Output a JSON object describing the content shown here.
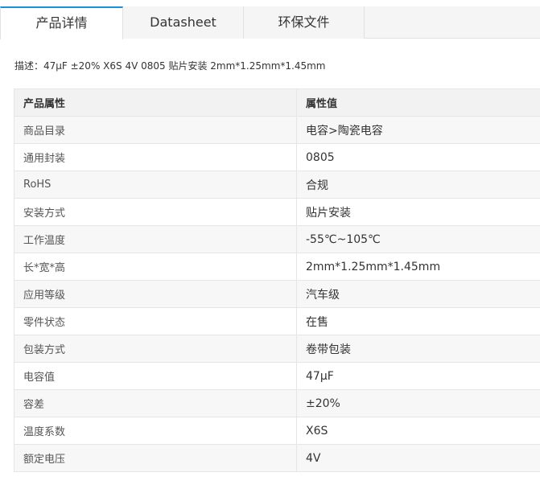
{
  "tabs": [
    {
      "label": "产品详情",
      "active": true
    },
    {
      "label": "Datasheet",
      "active": false
    },
    {
      "label": "环保文件",
      "active": false
    }
  ],
  "description": "描述：47μF ±20% X6S 4V 0805 贴片安装 2mm*1.25mm*1.45mm",
  "table": {
    "headers": [
      "产品属性",
      "属性值"
    ],
    "rows": [
      [
        "商品目录",
        "电容>陶瓷电容"
      ],
      [
        "通用封装",
        "0805"
      ],
      [
        "RoHS",
        "合规"
      ],
      [
        "安装方式",
        "贴片安装"
      ],
      [
        "工作温度",
        "-55℃~105℃"
      ],
      [
        "长*宽*高",
        "2mm*1.25mm*1.45mm"
      ],
      [
        "应用等级",
        "汽车级"
      ],
      [
        "零件状态",
        "在售"
      ],
      [
        "包装方式",
        "卷带包装"
      ],
      [
        "电容值",
        "47μF"
      ],
      [
        "容差",
        "±20%"
      ],
      [
        "温度系数",
        "X6S"
      ],
      [
        "额定电压",
        "4V"
      ]
    ]
  },
  "colors": {
    "accent": "#1a8fd9",
    "tab_bg": "#f5f5f5",
    "header_bg": "#f2f2f2",
    "zebra_bg": "#f7f7f7",
    "border": "#e6e6e6"
  }
}
